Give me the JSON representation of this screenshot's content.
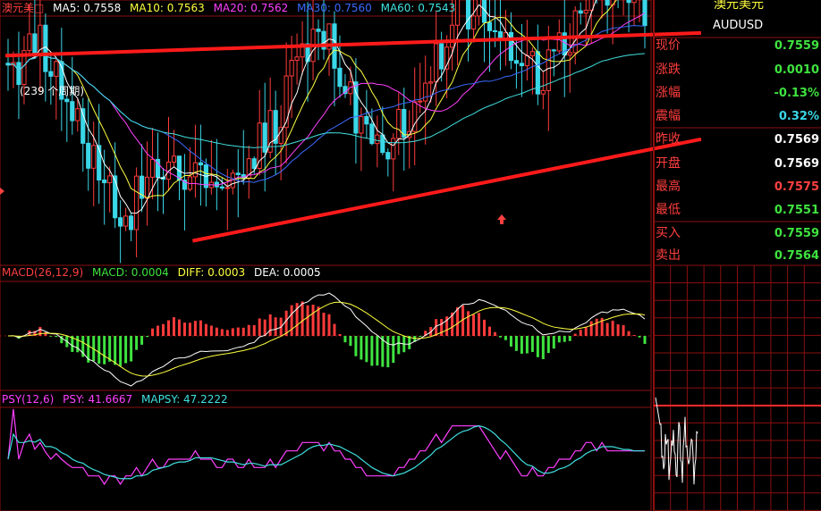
{
  "main_legend": {
    "symbol": "澳元美□",
    "ma5": "MA5: 0.7558",
    "ma10": "MA10: 0.7563",
    "ma20": "MA20: 0.7562",
    "ma30": "MA30: 0.7560",
    "ma60": "MA60: 0.7543"
  },
  "annotation_period": "(239 个周期)",
  "macd_legend": {
    "name": "MACD(26,12,9)",
    "macd": "MACD: 0.0004",
    "diff": "DIFF: 0.0003",
    "dea": "DEA: 0.0005"
  },
  "psy_legend": {
    "name": "PSY(12,6)",
    "psy": "PSY: 41.6667",
    "mapsy": "MAPSY: 47.2222"
  },
  "side_panel": {
    "title": "澳元美元",
    "code": "AUDUSD",
    "rows": [
      {
        "label": "现价",
        "value": "0.7559",
        "color": "#3fe33f"
      },
      {
        "label": "涨跌",
        "value": "0.0010",
        "color": "#3fe33f"
      },
      {
        "label": "涨幅",
        "value": "-0.13%",
        "color": "#3fe33f"
      },
      {
        "label": "震幅",
        "value": "0.32%",
        "color": "#3ad7e8"
      },
      {
        "label": "昨收",
        "value": "0.7569",
        "color": "#ffffff"
      },
      {
        "label": "开盘",
        "value": "0.7569",
        "color": "#ffffff"
      },
      {
        "label": "最高",
        "value": "0.7575",
        "color": "#ff4040"
      },
      {
        "label": "最低",
        "value": "0.7551",
        "color": "#3fe33f"
      },
      {
        "label": "买入",
        "value": "0.7559",
        "color": "#3fe33f"
      },
      {
        "label": "卖出",
        "value": "0.7564",
        "color": "#3fe33f"
      }
    ]
  },
  "colors": {
    "grid": "#8b0f0f",
    "up": "#ff3b3b",
    "down": "#3ad7e8",
    "ma5": "#ffffff",
    "ma10": "#ffff40",
    "ma20": "#ff40ff",
    "ma30": "#3b6bff",
    "ma60": "#40e0e0",
    "trend": "#ff1a1a",
    "macd_up": "#ff3b3b",
    "macd_down": "#3fe33f",
    "diff": "#ffffff",
    "dea": "#ffff40",
    "psy": "#ff40ff",
    "mapsy": "#40e0e0"
  },
  "chart_data": [
    {
      "type": "candlestick",
      "title": "澳元美□",
      "series_names": [
        "MA5",
        "MA10",
        "MA20",
        "MA30",
        "MA60"
      ],
      "ylim": [
        0.7535,
        0.76
      ],
      "n_bars": 120,
      "seed": 20240601,
      "trend_lines": [
        {
          "from": [
            0,
            0.759
          ],
          "to": [
            120,
            0.7596
          ]
        },
        {
          "from": [
            35,
            0.7541
          ],
          "to": [
            120,
            0.7566
          ]
        }
      ]
    },
    {
      "type": "bar",
      "title": "MACD(26,12,9)",
      "series_names": [
        "MACD",
        "DIFF",
        "DEA"
      ],
      "latest": {
        "MACD": 0.0004,
        "DIFF": 0.0003,
        "DEA": 0.0005
      }
    },
    {
      "type": "line",
      "title": "PSY(12,6)",
      "series_names": [
        "PSY",
        "MAPSY"
      ],
      "ylim": [
        0,
        100
      ],
      "latest": {
        "PSY": 41.6667,
        "MAPSY": 47.2222
      }
    }
  ]
}
